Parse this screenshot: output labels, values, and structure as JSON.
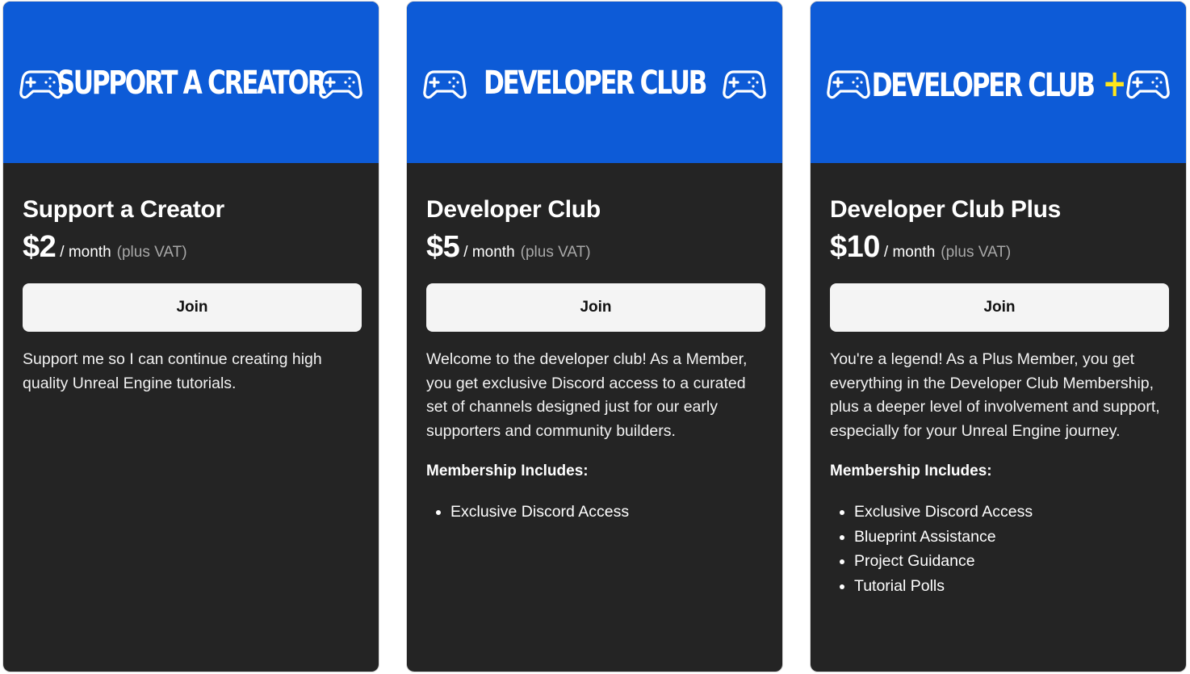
{
  "colors": {
    "banner": "#0d5bd7",
    "card": "#242424",
    "plus_accent": "#ffe61a",
    "button": "#f4f4f4"
  },
  "tiers": [
    {
      "banner_title": "SUPPORT A CREATOR",
      "banner_plus": "",
      "name": "Support a Creator",
      "price": "$2",
      "period": "/ month",
      "vat": "(plus VAT)",
      "join_label": "Join",
      "description": "Support me so I can continue creating high quality Unreal Engine tutorials.",
      "includes_title": "",
      "perks": []
    },
    {
      "banner_title": "DEVELOPER CLUB",
      "banner_plus": "",
      "name": "Developer Club",
      "price": "$5",
      "period": "/ month",
      "vat": "(plus VAT)",
      "join_label": "Join",
      "description": "Welcome to the developer club! As a Member, you get exclusive Discord access to a curated set of channels designed just for our early supporters and community builders.",
      "includes_title": "Membership Includes:",
      "perks": [
        "Exclusive Discord Access"
      ]
    },
    {
      "banner_title": "DEVELOPER CLUB",
      "banner_plus": "+",
      "name": "Developer Club Plus",
      "price": "$10",
      "period": "/ month",
      "vat": "(plus VAT)",
      "join_label": "Join",
      "description": "You're a legend! As a Plus Member, you get everything in the Developer Club Membership, plus a deeper level of involvement and support, especially for your Unreal Engine journey.",
      "includes_title": "Membership Includes:",
      "perks": [
        "Exclusive Discord Access",
        "Blueprint Assistance",
        "Project Guidance",
        "Tutorial Polls"
      ]
    }
  ]
}
